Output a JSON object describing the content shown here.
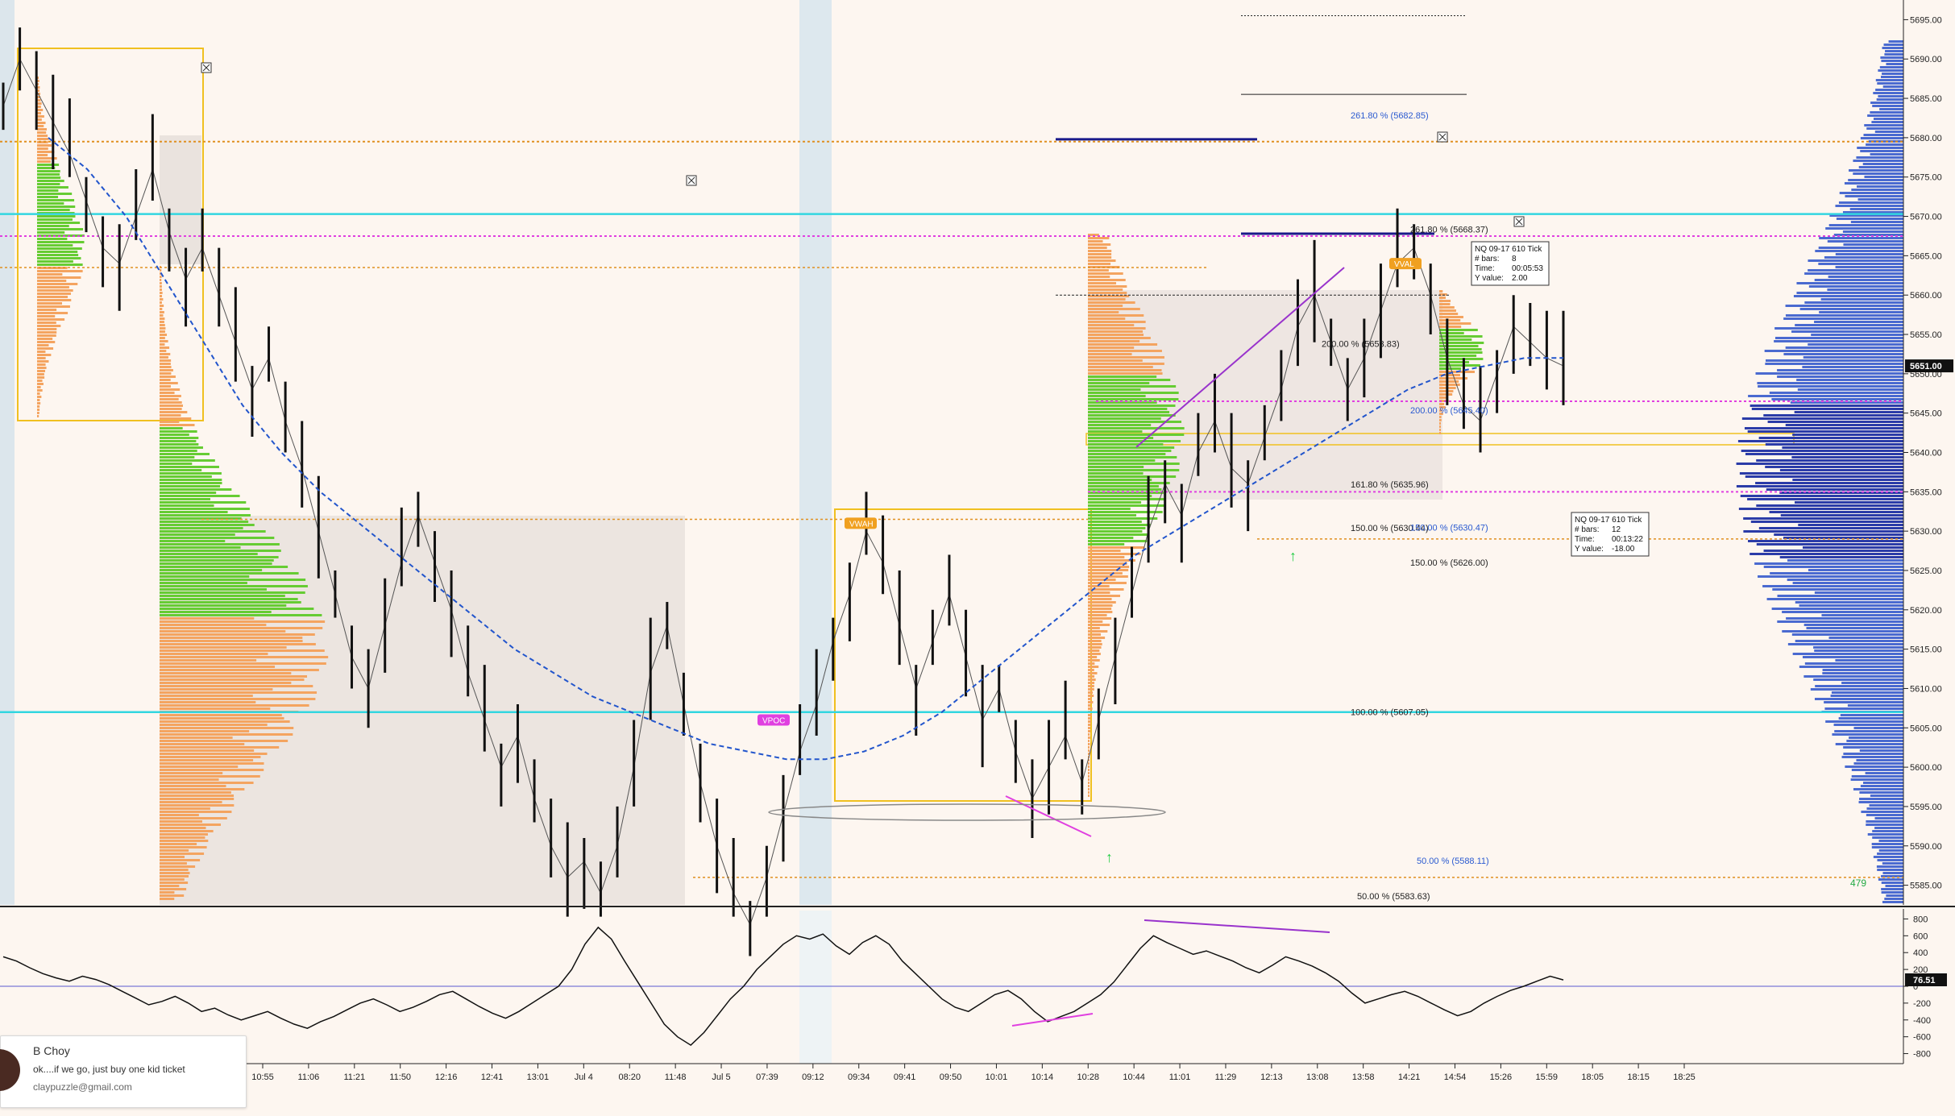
{
  "chart_data": [
    {
      "type": "line",
      "y_ticks": [
        5695,
        5690,
        5685,
        5680,
        5675,
        5670,
        5665,
        5660,
        5655,
        5650,
        5645,
        5640,
        5635,
        5630,
        5625,
        5620,
        5615,
        5610,
        5605,
        5600,
        5595,
        5590,
        5585
      ],
      "y_tick_labels": [
        "5695.00",
        "5690.00",
        "5685.00",
        "5680.00",
        "5675.00",
        "5670.00",
        "5665.00",
        "5660.00",
        "5655.00",
        "5650.00",
        "5645.00",
        "5640.00",
        "5635.00",
        "5630.00",
        "5625.00",
        "5620.00",
        "5615.00",
        "5610.00",
        "5605.00",
        "5600.00",
        "5595.00",
        "5590.00",
        "5585.00"
      ],
      "ylim": [
        5582.5,
        5697.5
      ],
      "last_price": 5651.0,
      "last_price_label": "5651.00",
      "x_labels": [
        "10:55",
        "11:06",
        "11:21",
        "11:50",
        "12:16",
        "12:41",
        "13:01",
        "Jul 4",
        "08:20",
        "11:48",
        "Jul 5",
        "07:39",
        "09:12",
        "09:34",
        "09:41",
        "09:50",
        "10:01",
        "10:14",
        "10:28",
        "10:44",
        "11:01",
        "11:29",
        "12:13",
        "13:08",
        "13:58",
        "14:21",
        "14:54",
        "15:26",
        "15:59",
        "18:05",
        "18:15",
        "18:25"
      ],
      "price_series": [
        5684,
        5690,
        5686,
        5682,
        5678,
        5672,
        5666,
        5664,
        5670,
        5676,
        5668,
        5662,
        5666,
        5660,
        5654,
        5648,
        5652,
        5644,
        5638,
        5630,
        5622,
        5614,
        5610,
        5618,
        5626,
        5632,
        5626,
        5620,
        5612,
        5606,
        5600,
        5604,
        5596,
        5590,
        5586,
        5588,
        5584,
        5590,
        5600,
        5612,
        5618,
        5608,
        5598,
        5590,
        5584,
        5580,
        5586,
        5594,
        5602,
        5608,
        5616,
        5622,
        5630,
        5626,
        5618,
        5610,
        5616,
        5622,
        5614,
        5606,
        5610,
        5602,
        5596,
        5600,
        5604,
        5598,
        5606,
        5614,
        5622,
        5630,
        5636,
        5632,
        5640,
        5644,
        5638,
        5636,
        5642,
        5648,
        5656,
        5660,
        5654,
        5648,
        5652,
        5658,
        5664,
        5666,
        5660,
        5652,
        5646,
        5644,
        5650,
        5656,
        5654,
        5652,
        5651
      ],
      "ma_series": [
        5680,
        5676,
        5670,
        5662,
        5654,
        5646,
        5640,
        5635,
        5631,
        5627,
        5623,
        5619,
        5615,
        5612,
        5609,
        5607,
        5605,
        5603,
        5602,
        5601,
        5601,
        5602,
        5604,
        5607,
        5611,
        5615,
        5619,
        5623,
        5627,
        5630,
        5633,
        5636,
        5639,
        5642,
        5645,
        5648,
        5650,
        5651,
        5652,
        5652
      ],
      "fib_labels": [
        {
          "text": "261.80 % (5682.85)",
          "value": 5682.85
        },
        {
          "text": "261.80 % (5668.37)",
          "value": 5668.37
        },
        {
          "text": "200.00 % (5653.83)",
          "value": 5653.83
        },
        {
          "text": "200.00 % (5645.40)",
          "value": 5645.4
        },
        {
          "text": "161.80 % (5635.96)",
          "value": 5635.96
        },
        {
          "text": "150.00 % (5630.44)",
          "value": 5630.44
        },
        {
          "text": "150.00 % (5630.47)",
          "value": 5630.47
        },
        {
          "text": "150.00 % (5626.00)",
          "value": 5626.0
        },
        {
          "text": "100.00 % (5607.05)",
          "value": 5607.05
        },
        {
          "text": "50.00 % (5588.11)",
          "value": 5588.11
        },
        {
          "text": "50.00 % (5583.63)",
          "value": 5583.63
        }
      ],
      "level_tags": [
        {
          "text": "VPOC",
          "value": 5606,
          "color": "#e040e0"
        },
        {
          "text": "VWAH",
          "value": 5631,
          "color": "#f0a020"
        },
        {
          "text": "VVAL",
          "value": 5664,
          "color": "#f0a020"
        }
      ],
      "measure_boxes": [
        {
          "title": "NQ 09-17 610 Tick",
          "bars_label": "# bars:",
          "bars": "8",
          "time_label": "Time:",
          "time": "00:05:53",
          "y_label": "Y value:",
          "y": "2.00"
        },
        {
          "title": "NQ 09-17 610 Tick",
          "bars_label": "# bars:",
          "bars": "12",
          "time_label": "Time:",
          "time": "00:13:22",
          "y_label": "Y value:",
          "y": "-18.00"
        }
      ],
      "volume_count_label": "479",
      "colors": {
        "price": "#111111",
        "ma": "#2255cc",
        "cyan": "#33d6e0",
        "orange": "#f4a460",
        "green": "#66cc33",
        "profile_blue": "#2b3ca8",
        "gold": "#f0c020",
        "magenta": "#e040e0",
        "purple": "#9933cc"
      }
    },
    {
      "type": "line",
      "y_ticks": [
        800,
        600,
        400,
        200,
        0,
        -200,
        -400,
        -600,
        -800
      ],
      "y_tick_labels": [
        "800",
        "600",
        "400",
        "200",
        "0",
        "-200",
        "-400",
        "-600",
        "-800"
      ],
      "ylim": [
        -900,
        900
      ],
      "last_value_label": "76.51",
      "last_value": 76.51,
      "values": [
        350,
        300,
        220,
        150,
        100,
        60,
        120,
        80,
        20,
        -60,
        -140,
        -220,
        -180,
        -120,
        -200,
        -300,
        -260,
        -340,
        -400,
        -350,
        -300,
        -380,
        -450,
        -500,
        -420,
        -360,
        -280,
        -200,
        -150,
        -220,
        -300,
        -250,
        -180,
        -100,
        -60,
        -150,
        -240,
        -320,
        -380,
        -300,
        -200,
        -100,
        0,
        200,
        500,
        700,
        560,
        300,
        50,
        -200,
        -450,
        -600,
        -700,
        -550,
        -350,
        -150,
        0,
        200,
        350,
        500,
        600,
        560,
        620,
        480,
        380,
        520,
        600,
        500,
        300,
        150,
        0,
        -150,
        -250,
        -300,
        -200,
        -100,
        -50,
        -150,
        -300,
        -420,
        -360,
        -300,
        -200,
        -100,
        50,
        250,
        450,
        600,
        520,
        450,
        380,
        420,
        360,
        300,
        220,
        160,
        250,
        350,
        300,
        240,
        160,
        60,
        -80,
        -200,
        -150,
        -100,
        -60,
        -120,
        -200,
        -280,
        -350,
        -300,
        -200,
        -120,
        -50,
        0,
        60,
        120,
        76
      ]
    }
  ],
  "chat": {
    "name": "B Choy",
    "message": "ok....if we go, just buy one kid ticket",
    "email": "claypuzzle@gmail.com"
  }
}
